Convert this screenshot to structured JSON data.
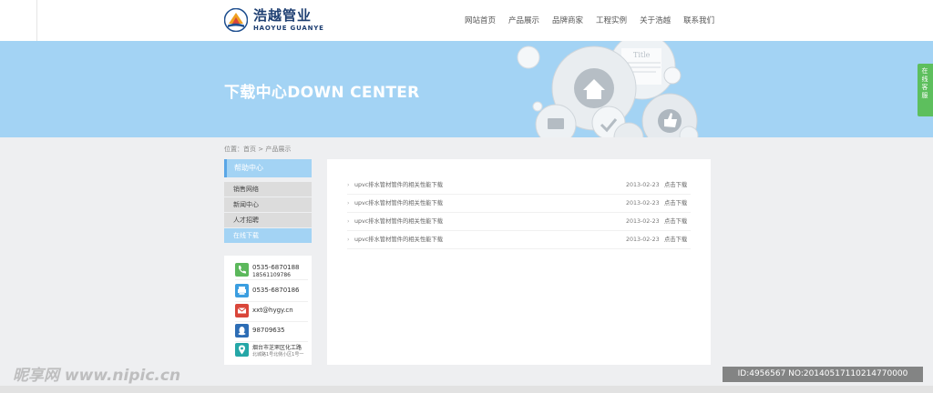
{
  "brand": {
    "name_cn": "浩越管业",
    "name_en": "HAOYUE GUANYE"
  },
  "nav": {
    "items": [
      "网站首页",
      "产品展示",
      "品牌商家",
      "工程实例",
      "关于浩越",
      "联系我们"
    ]
  },
  "banner": {
    "title": "下载中心DOWN CENTER",
    "art_label": "Title"
  },
  "side_tab": {
    "label": "在线客服"
  },
  "breadcrumb": {
    "text": "位置：首页 > 产品展示"
  },
  "sidebar": {
    "header": "帮助中心",
    "items": [
      {
        "label": "销售网络",
        "active": false
      },
      {
        "label": "新闻中心",
        "active": false
      },
      {
        "label": "人才招聘",
        "active": false
      },
      {
        "label": "在线下载",
        "active": true
      }
    ]
  },
  "contact": {
    "items": [
      {
        "icon": "phone-icon",
        "color": "#5cb85c",
        "text": "0535-6870188",
        "sub": "18561109786"
      },
      {
        "icon": "fax-icon",
        "color": "#3b9ee0",
        "text": "0535-6870186",
        "sub": ""
      },
      {
        "icon": "mail-icon",
        "color": "#d9463a",
        "text": "xxt@hygy.cn",
        "sub": ""
      },
      {
        "icon": "qq-icon",
        "color": "#2d6db5",
        "text": "98709635",
        "sub": ""
      },
      {
        "icon": "location-icon",
        "color": "#25a7a7",
        "text": "烟台市芝罘区化工路",
        "sub": "北城路1号北侧小区1号一"
      }
    ]
  },
  "downloads": {
    "rows": [
      {
        "title": "upvc排水管材管件的相关性能下载",
        "date": "2013-02-23",
        "action": "点击下载"
      },
      {
        "title": "upvc排水管材管件的相关性能下载",
        "date": "2013-02-23",
        "action": "点击下载"
      },
      {
        "title": "upvc排水管材管件的相关性能下载",
        "date": "2013-02-23",
        "action": "点击下载"
      },
      {
        "title": "upvc排水管材管件的相关性能下载",
        "date": "2013-02-23",
        "action": "点击下载"
      }
    ]
  },
  "watermark": {
    "left": "昵享网 www.nipic.cn",
    "right": "ID:4956567 NO:20140517110214770000"
  },
  "colors": {
    "banner": "#a3d3f4",
    "accent": "#5aa6e6",
    "side_tab": "#5dbf5d"
  }
}
